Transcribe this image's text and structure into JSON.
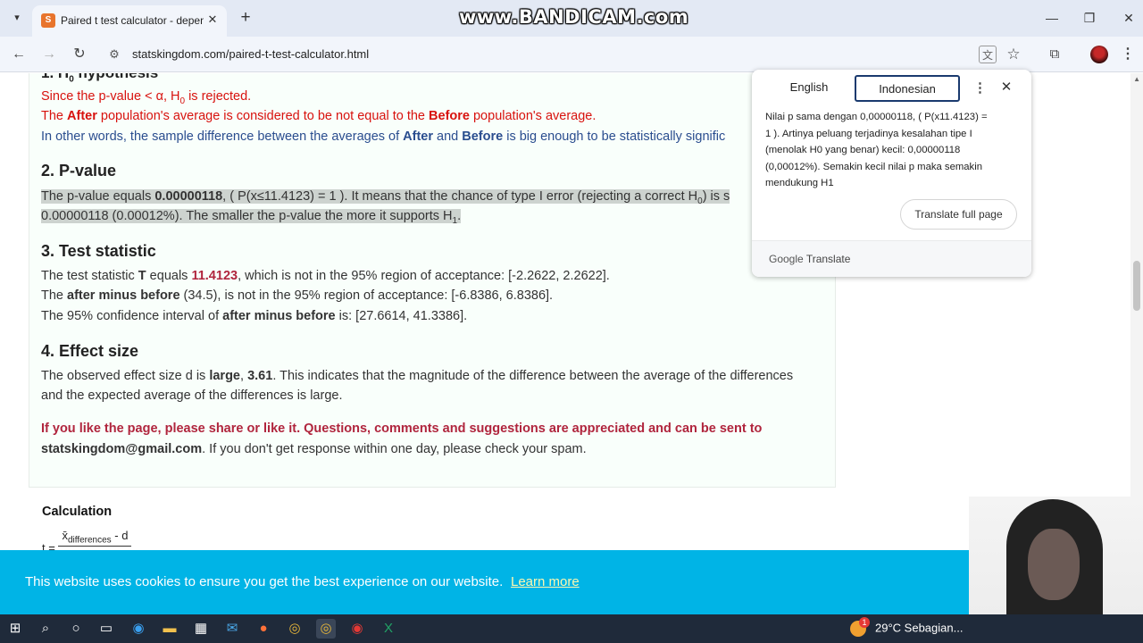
{
  "browser": {
    "tab_title": "Paired t test calculator - depend",
    "url": "statskingdom.com/paired-t-test-calculator.html",
    "watermark": "www.BANDICAM.com"
  },
  "content": {
    "h0_conclusion": {
      "line1_a": "Since the p-value < α, H",
      "line1_sub": "0",
      "line1_b": " is rejected.",
      "line2_a": "The ",
      "line2_b": "After",
      "line2_c": " population's average is considered to be not equal to the ",
      "line2_d": "Before",
      "line2_e": " population's average.",
      "line3_a": "In other words, the sample difference between the averages of ",
      "line3_b": "After",
      "line3_c": " and ",
      "line3_d": "Before",
      "line3_e": " is big enough to be statistically signific"
    },
    "pvalue": {
      "heading": "2. P-value",
      "p1_a": "The p-value equals ",
      "p1_b": "0.00000118",
      "p1_c": ", ( P(x≤11.4123) = 1 ). It means that the chance of type I error (rejecting a correct H",
      "p1_sub": "0",
      "p1_d": ") is s",
      "p2_a": "0.00000118 (0.00012%). The smaller the p-value the more it supports H",
      "p2_sub": "1",
      "p2_b": "."
    },
    "test_statistic": {
      "heading": "3. Test statistic",
      "l1_a": "The test statistic ",
      "l1_b": "T",
      "l1_c": " equals ",
      "l1_d": "11.4123",
      "l1_e": ", which is not in the 95% region of acceptance: [-2.2622, 2.2622].",
      "l2_a": "The ",
      "l2_b": "after minus before",
      "l2_c": " (34.5), is not in the 95% region of acceptance: [-6.8386, 6.8386].",
      "l3_a": "The 95% confidence interval of ",
      "l3_b": "after minus before",
      "l3_c": " is: [27.6614, 41.3386]."
    },
    "effect_size": {
      "heading": "4. Effect size",
      "l1_a": "The observed effect size d is ",
      "l1_b": "large",
      "l1_c": ", ",
      "l1_d": "3.61",
      "l1_e": ". This indicates that the magnitude of the difference between the average of the differences",
      "l2": "and the expected average of the differences is large."
    },
    "share": {
      "l1": "If you like the page, please share or like it. Questions, comments and suggestions are appreciated and can be sent to",
      "email": "statskingdom@gmail.com",
      "l2_rest": ". If you don't get response within one day, please check your spam."
    },
    "calculation": {
      "heading": "Calculation",
      "formula_t": "t = ",
      "formula_numerator_a": "x̄",
      "formula_numerator_sub": "differences",
      "formula_numerator_b": " - d"
    }
  },
  "translate_popup": {
    "tab_source": "English",
    "tab_target": "Indonesian",
    "body": "Nilai p sama dengan 0,00000118, ( P(x11.4123) =\n1 ). Artinya peluang terjadinya kesalahan tipe I\n(menolak H0 yang benar) kecil: 0,00000118\n(0,00012%). Semakin kecil nilai p maka semakin\nmendukung H1",
    "button": "Translate full page",
    "footer_google": "Google",
    "footer_translate": " Translate"
  },
  "cookie": {
    "text": "This website uses cookies to ensure you get the best experience on our website.",
    "link": "Learn more"
  },
  "taskbar": {
    "weather_temp": "29°C",
    "weather_desc": "Sebagian...",
    "weather_badge": "1"
  },
  "colors": {
    "red_text": "#d8120e",
    "blue_text": "#2a4d8f",
    "maroon_text": "#b0253d",
    "cookie_bg": "#00b4e6",
    "highlight": "#cdd3cf"
  },
  "icons": {
    "tab_menu": "chevron-down-icon",
    "favicon": "site-favicon",
    "back": "arrow-left-icon",
    "forward": "arrow-right-icon",
    "reload": "reload-icon",
    "site_info": "tune-icon",
    "translate": "translate-icon",
    "bookmark": "star-icon",
    "extensions": "puzzle-icon",
    "menu": "kebab-menu-icon"
  }
}
